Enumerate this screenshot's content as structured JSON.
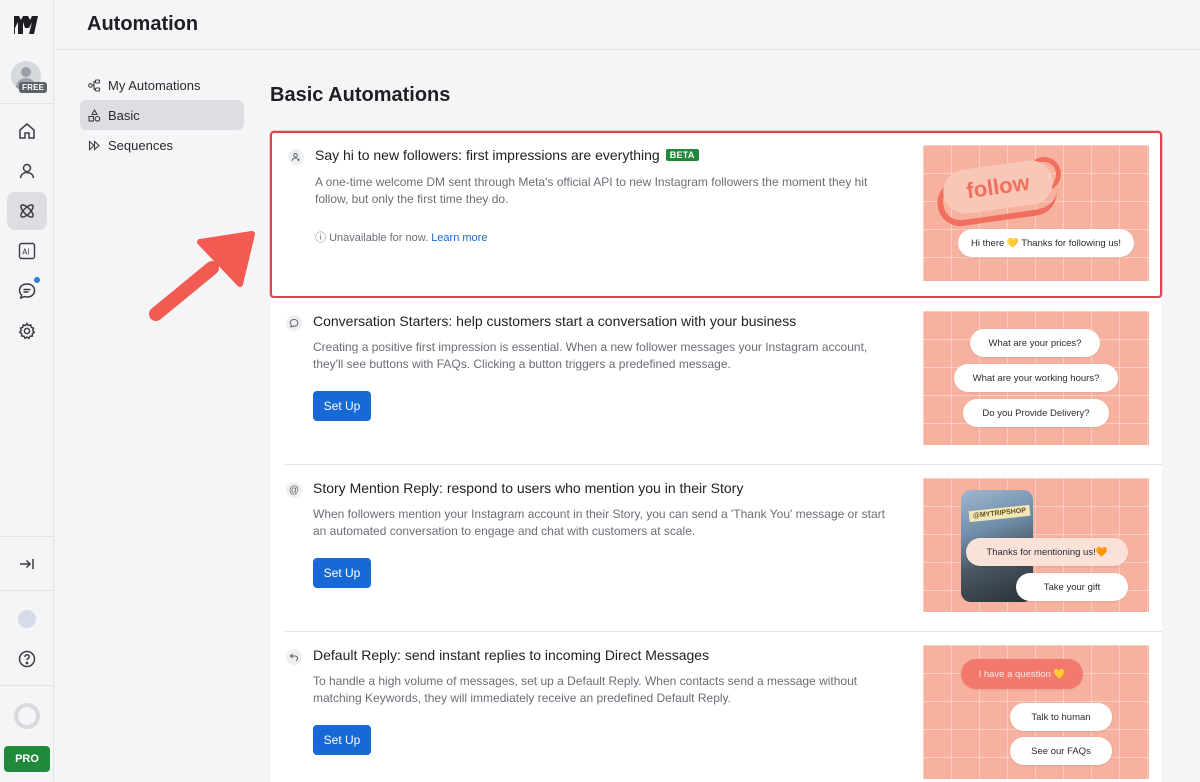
{
  "header": {
    "title": "Automation"
  },
  "rail": {
    "free_badge": "FREE",
    "pro_label": "PRO"
  },
  "subnav": {
    "items": [
      {
        "label": "My Automations",
        "icon": "flow-icon"
      },
      {
        "label": "Basic",
        "icon": "shapes-icon"
      },
      {
        "label": "Sequences",
        "icon": "fast-forward-icon"
      }
    ]
  },
  "main": {
    "title": "Basic Automations",
    "cards": [
      {
        "title": "Say hi to new followers: first impressions are everything",
        "badge": "BETA",
        "description": "A one-time welcome DM sent through Meta's official API to new Instagram followers the moment they hit follow, but only the first time they do.",
        "unavailable_text": "Unavailable for now.",
        "learn_more": "Learn more",
        "preview": {
          "follow_text": "follow",
          "bubble": "Hi there 💛 Thanks for following us!"
        }
      },
      {
        "title": "Conversation Starters: help customers start a conversation with your business",
        "description": "Creating a positive first impression is essential. When a new follower messages your Instagram account, they'll see buttons with FAQs. Clicking a button triggers a predefined message.",
        "button": "Set Up",
        "preview": {
          "q1": "What are your prices?",
          "q2": "What are your working hours?",
          "q3": "Do you Provide Delivery?"
        }
      },
      {
        "title": "Story Mention Reply: respond to users who mention you in their Story",
        "description": "When followers mention your Instagram account in their Story, you can send a 'Thank You' message or start an automated conversation to engage and chat with customers at scale.",
        "button": "Set Up",
        "preview": {
          "tag": "@MYTRIPSHOP",
          "b1": "Thanks for mentioning us!🧡",
          "b2": "Take your gift"
        }
      },
      {
        "title": "Default Reply: send instant replies to incoming Direct Messages",
        "description": "To handle a high volume of messages, set up a Default Reply. When contacts send a message without matching Keywords, they will immediately receive an predefined Default Reply.",
        "button": "Set Up",
        "preview": {
          "b1": "I have a question 💛",
          "b2": "Talk to human",
          "b3": "See our FAQs"
        }
      }
    ]
  },
  "colors": {
    "accent": "#1769d6",
    "highlight": "#e0414b",
    "arrow": "#f25a52",
    "preview_bg": "#f6b29f",
    "beta": "#1e8a3a"
  }
}
